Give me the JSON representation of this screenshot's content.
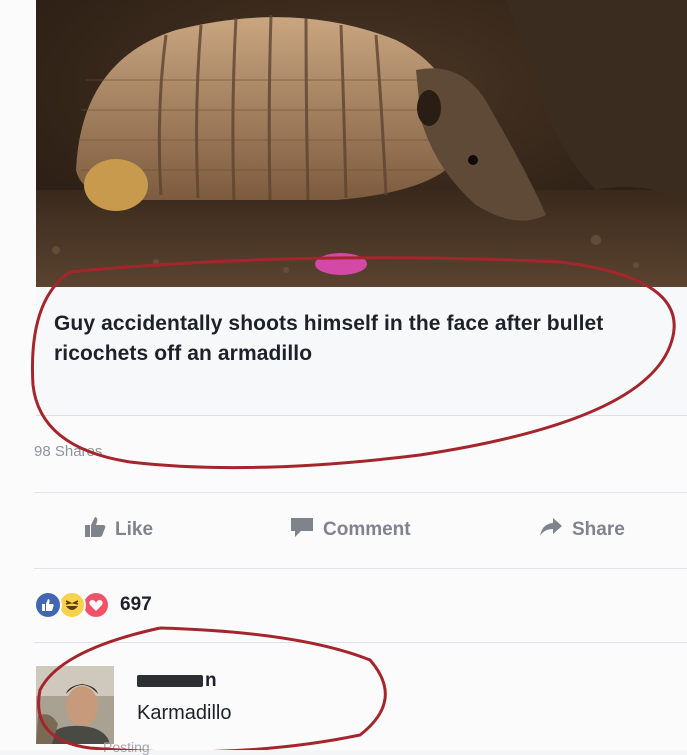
{
  "post": {
    "headline": "Guy accidentally shoots himself in the face after bullet ricochets off an armadillo",
    "shares": "98 Shares"
  },
  "actions": {
    "like": "Like",
    "comment": "Comment",
    "share": "Share"
  },
  "reactions": {
    "icons": [
      "like-icon",
      "haha-icon",
      "love-icon"
    ],
    "count": "697"
  },
  "comment": {
    "name_visible_fragment": "n",
    "text": "Karmadillo",
    "meta": "Posting"
  },
  "colors": {
    "like_blue": "#4267b2",
    "haha_yellow": "#f7d34b",
    "love_red": "#f25268",
    "annotation_red": "#a4262c",
    "muted_text": "#7f838b"
  }
}
